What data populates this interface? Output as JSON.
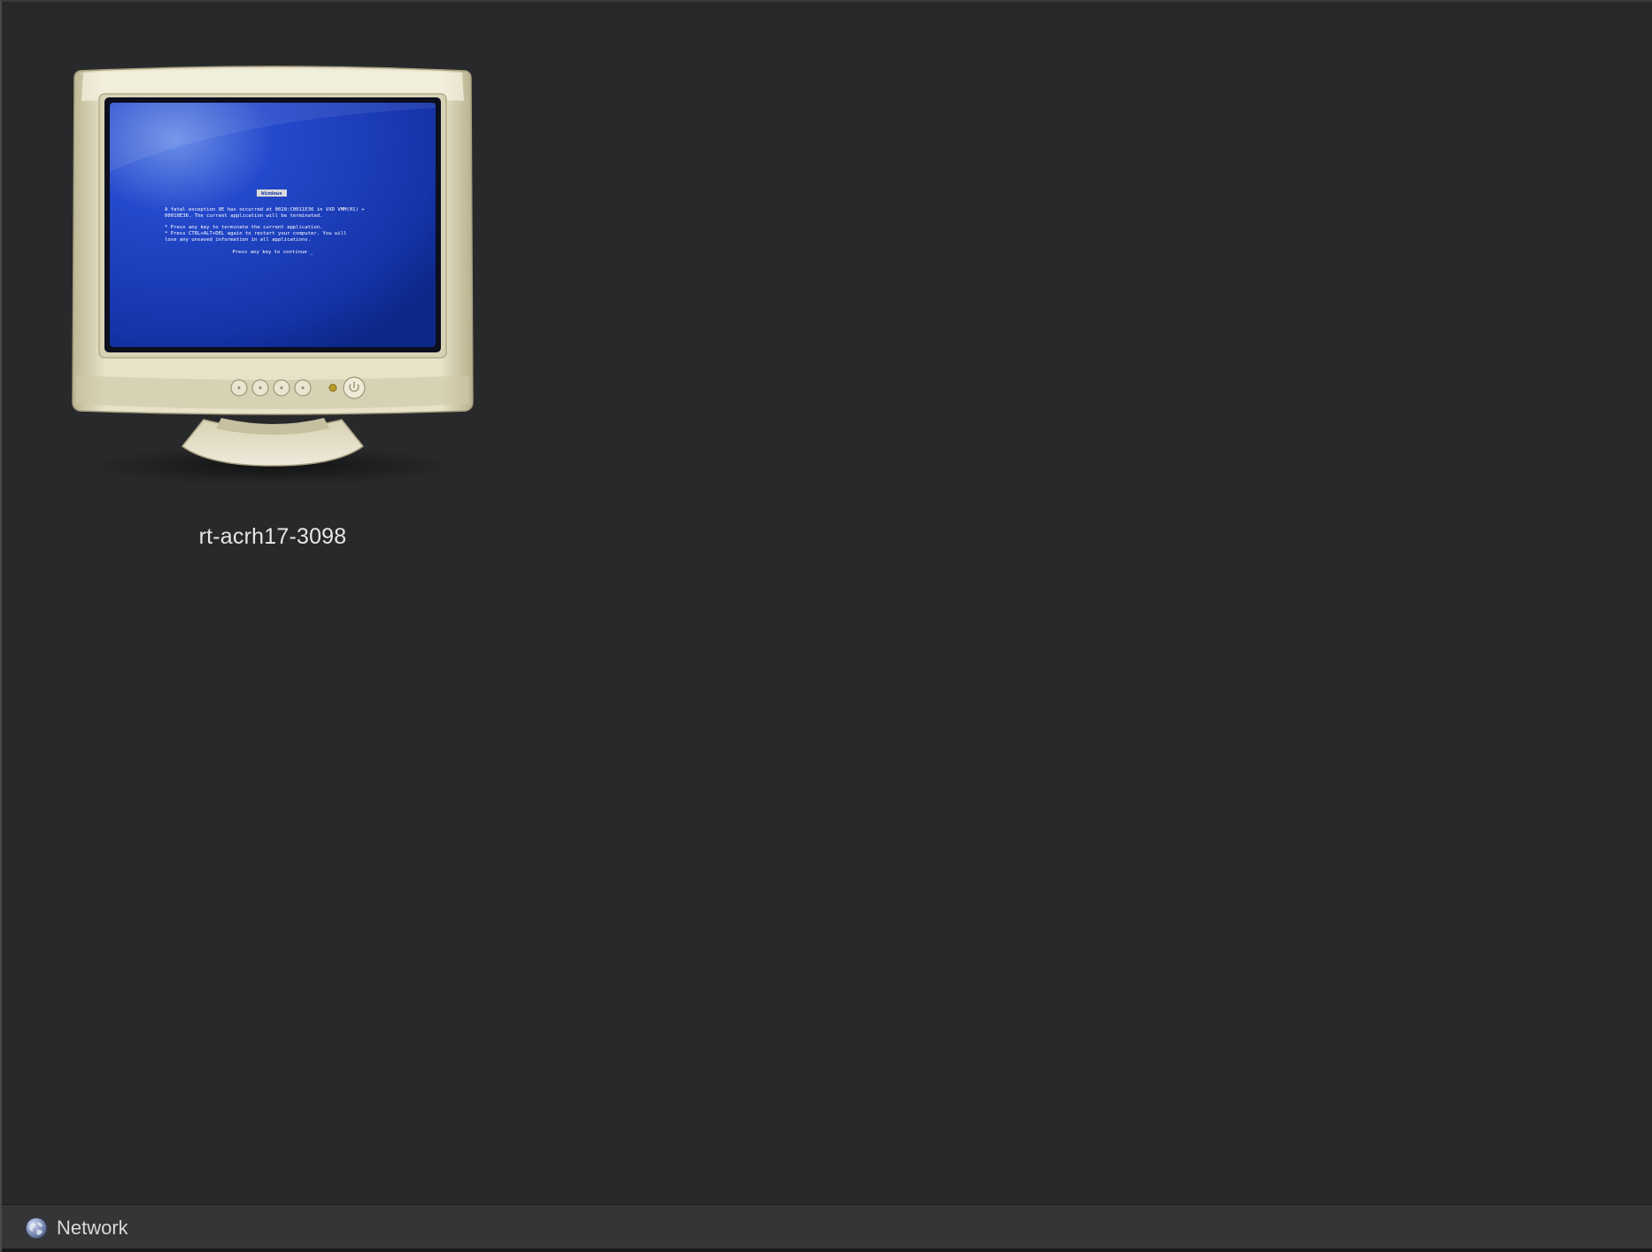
{
  "window": {
    "background": "#28292b"
  },
  "items": [
    {
      "label": "rt-acrh17-3098",
      "icon": "crt-monitor-icon",
      "screen": {
        "title": "Windows",
        "lines": [
          "A fatal exception 0E has occurred at 0028:C0011E36 in VXD VMM(01) +",
          "00010E36. The current application will be terminated.",
          "*  Press any key to terminate the current application.",
          "*  Press CTRL+ALT+DEL again to restart your computer. You will",
          "   lose any unsaved information in all applications.",
          "Press any key to continue _"
        ]
      }
    }
  ],
  "pathbar": {
    "icon": "network-globe-icon",
    "label": "Network"
  }
}
